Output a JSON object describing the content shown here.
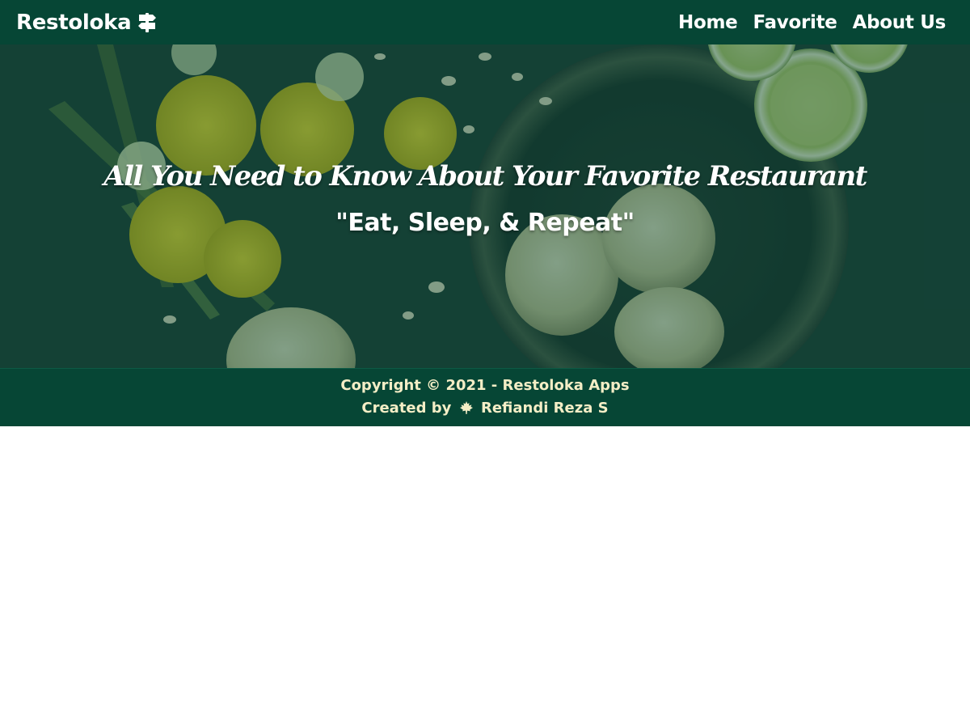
{
  "navbar": {
    "brand": "Restoloka",
    "brand_icon": "signpost-icon",
    "links": [
      "Home",
      "Favorite",
      "About Us"
    ]
  },
  "hero": {
    "title": "All You Need to Know About Your Favorite Restaurant",
    "tagline": "\"Eat, Sleep, & Repeat\""
  },
  "footer": {
    "copyright": "Copyright © 2021 - Restoloka Apps",
    "created_prefix": "Created by",
    "created_icon": "maple-leaf-icon",
    "author": "Refiandi Reza S"
  },
  "colors": {
    "primary": "#064635",
    "footer_text": "#f4eec6",
    "white": "#ffffff"
  }
}
